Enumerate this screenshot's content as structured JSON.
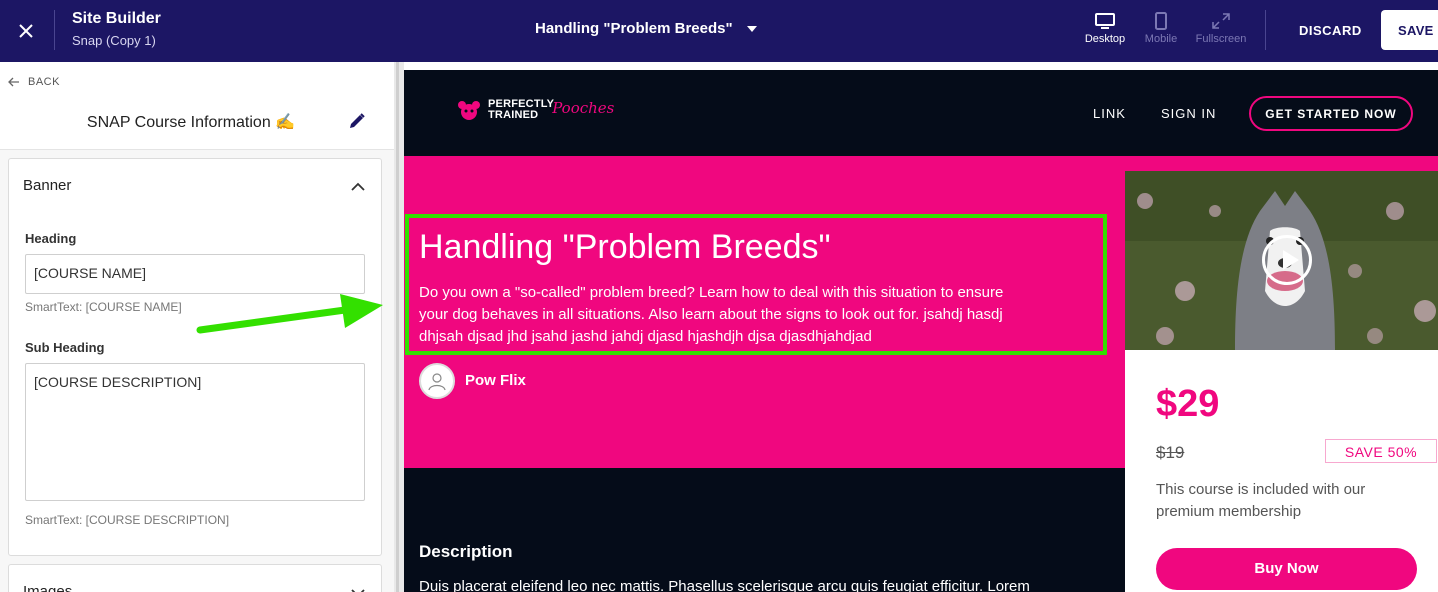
{
  "topbar": {
    "app_title": "Site Builder",
    "app_subtitle": "Snap (Copy 1)",
    "page_name": "Handling \"Problem Breeds\"",
    "views": {
      "desktop": "Desktop",
      "mobile": "Mobile",
      "fullscreen": "Fullscreen"
    },
    "discard_label": "DISCARD",
    "save_label": "SAVE"
  },
  "left_panel": {
    "back_label": "BACK",
    "section_title": "SNAP Course Information ✍",
    "banner": {
      "title": "Banner",
      "heading_label": "Heading",
      "heading_value": "[COURSE NAME]",
      "heading_smart": "SmartText: [COURSE NAME]",
      "subheading_label": "Sub Heading",
      "subheading_value": "[COURSE DESCRIPTION]",
      "subheading_smart": "SmartText: [COURSE DESCRIPTION]"
    },
    "images_title": "Images"
  },
  "preview": {
    "logo_line1": "PERFECTLY",
    "logo_line2": "TRAINED",
    "logo_script": "Pooches",
    "nav": {
      "link": "LINK",
      "sign_in": "SIGN IN",
      "cta": "GET STARTED NOW"
    },
    "hero_title": "Handling \"Problem Breeds\"",
    "hero_description": "Do you own a \"so-called\" problem breed? Learn how to deal with this situation to ensure your dog behaves in all situations. Also learn about the signs to look out for. jsahdj hasdj dhjsah djsad jhd jsahd jashd jahdj djasd hjashdjh djsa djasdhjahdjad",
    "author_name": "Pow Flix",
    "description_heading": "Description",
    "description_body": "Duis placerat eleifend leo nec mattis. Phasellus scelerisque arcu quis feugiat efficitur. Lorem",
    "price": "$29",
    "old_price": "$19",
    "save_badge": "SAVE 50%",
    "included_text": "This course is included with our premium membership",
    "buy_label": "Buy Now"
  },
  "colors": {
    "topbar": "#1c1664",
    "brand_pink": "#f0077f",
    "preview_bg": "#050c19",
    "annotation_green": "#33e000"
  }
}
